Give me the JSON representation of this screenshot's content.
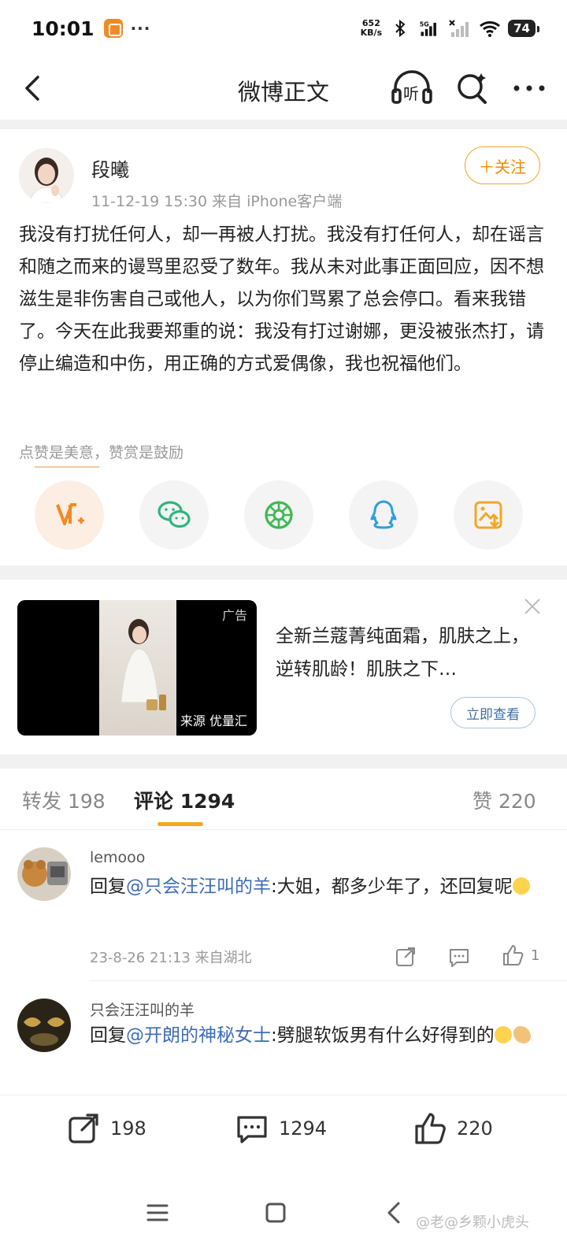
{
  "status_bar": {
    "time": "10:01",
    "more": "···",
    "speed_value": "652",
    "speed_unit": "KB/s",
    "network": "5G",
    "battery": "74"
  },
  "nav": {
    "title": "微博正文",
    "listen_label": "听"
  },
  "post": {
    "author": "段曦",
    "meta": "11-12-19 15:30  来自 iPhone客户端",
    "follow_label": "＋关注",
    "text": "我没有打扰任何人，却一再被人打扰。我没有打任何人，却在谣言和随之而来的谩骂里忍受了数年。我从未对此事正面回应，因不想滋生是非伤害自己或他人，以为你们骂累了总会停口。看来我错了。今天在此我要郑重的说：我没有打过谢娜，更没被张杰打，请停止编造和中伤，用正确的方式爱偶像，我也祝福他们。",
    "reward_hint": "点赞是美意，赞赏是鼓励",
    "share_icons": [
      "reward-icon",
      "wechat-icon",
      "moments-icon",
      "qq-icon",
      "save-image-icon"
    ]
  },
  "ad": {
    "label": "广告",
    "source": "来源 优量汇",
    "text": "全新兰蔻菁纯面霜，肌肤之上，逆转肌龄！肌肤之下…",
    "cta": "立即查看"
  },
  "tabs": {
    "repost": "转发 198",
    "comments": "评论 1294",
    "likes": "赞 220"
  },
  "comments": [
    {
      "name": "lemooo",
      "reply_prefix": "回复",
      "mention": "@只会汪汪叫的羊",
      "text": ":大姐，都多少年了，还回复呢",
      "meta": "23-8-26 21:13  来自湖北",
      "likes": "1"
    },
    {
      "name": "只会汪汪叫的羊",
      "reply_prefix": "回复",
      "mention": "@开朗的神秘女士",
      "text": ":劈腿软饭男有什么好得到的"
    }
  ],
  "bottom_bar": {
    "repost_count": "198",
    "comment_count": "1294",
    "like_count": "220"
  },
  "watermark": "@老@乡颗小虎头",
  "colors": {
    "accent_orange": "#f5a623",
    "mention_blue": "#3e6cb5",
    "cta_blue": "#3d6fa3"
  }
}
